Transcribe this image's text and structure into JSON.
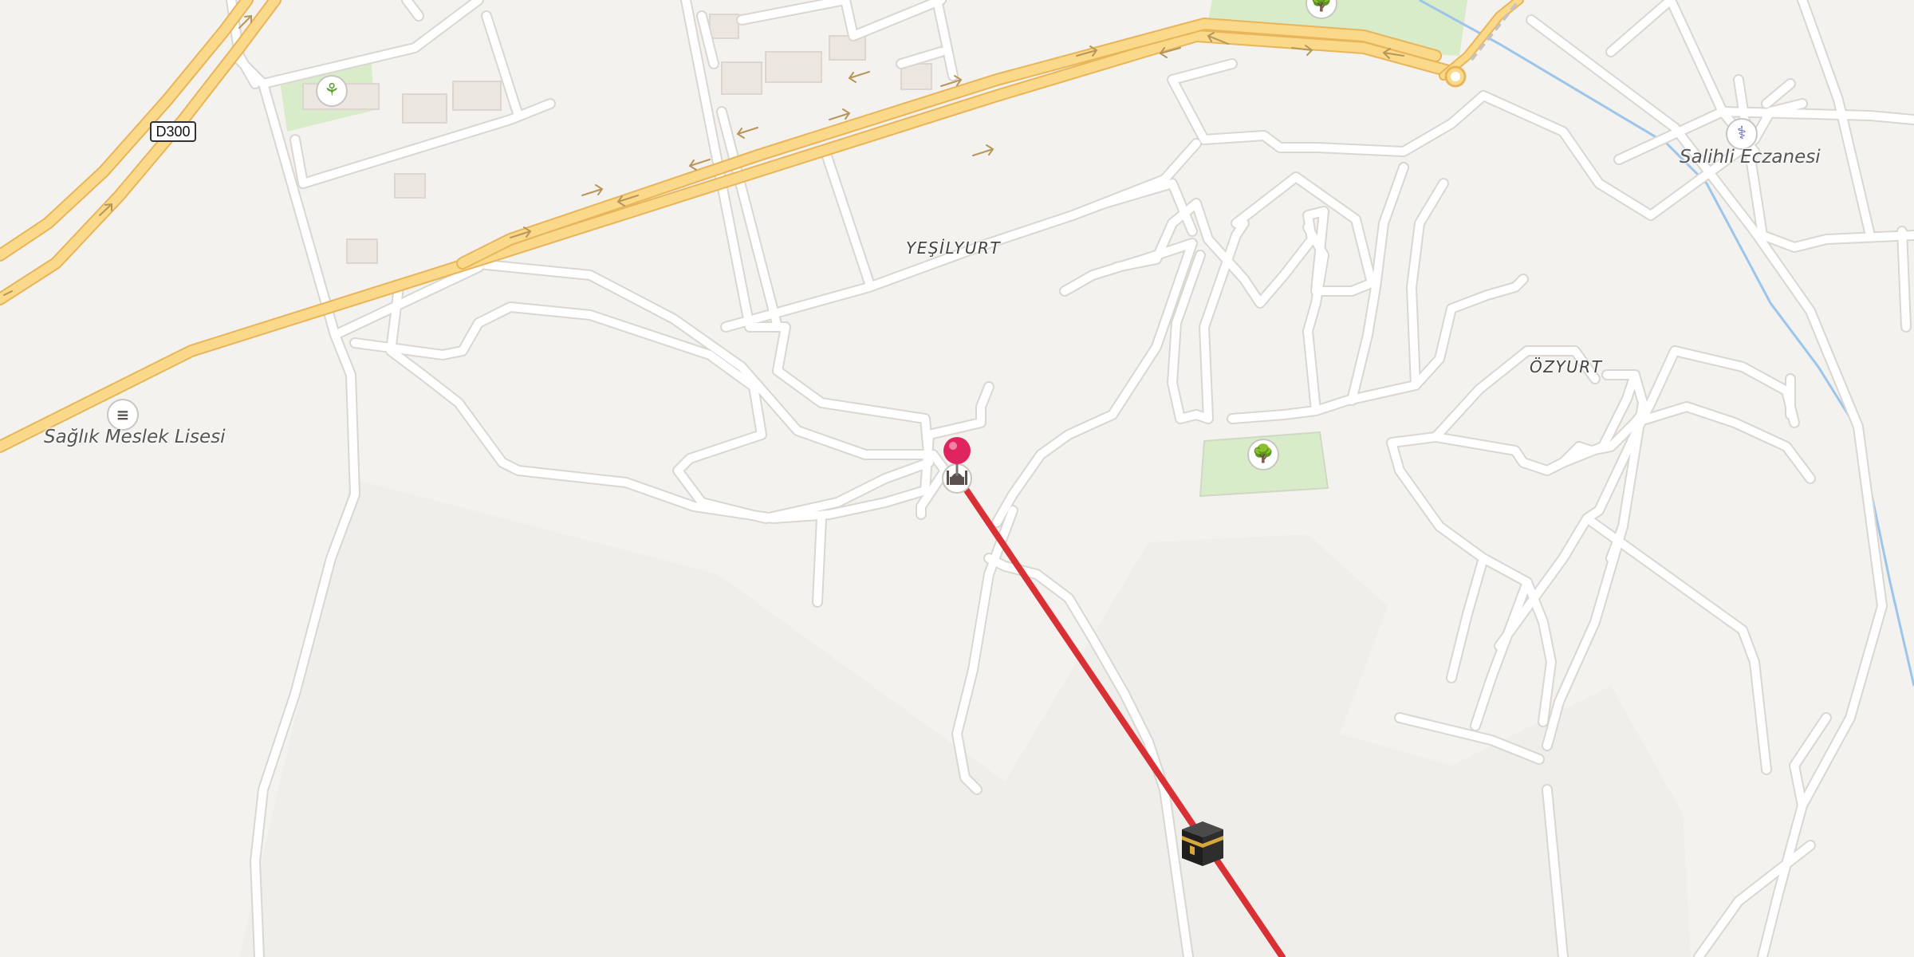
{
  "map": {
    "road_shield": {
      "label": "D300"
    },
    "place_labels": {
      "yesilyurt": "YEŞİLYURT",
      "ozyurt": "ÖZYURT"
    },
    "poi_labels": {
      "school": "Sağlık Meslek Lisesi",
      "pharmacy": "Salihli Eczanesi"
    },
    "icons": {
      "school": "school-icon",
      "pharmacy": "pharmacy-icon",
      "park": "tree-icon",
      "garden": "garden-icon",
      "mosque": "mosque-icon",
      "location_pin": "location-pin-icon",
      "kaaba": "kaaba-icon"
    },
    "colors": {
      "background": "#f4f2ef",
      "road": "#ffffff",
      "road_casing": "#dad6d1",
      "highway": "#fbd98a",
      "highway_casing": "#e8b55a",
      "park": "#d9ecc9",
      "water": "#9cc5ec",
      "qibla_line": "#d93036",
      "pin": "#e0245e"
    }
  }
}
